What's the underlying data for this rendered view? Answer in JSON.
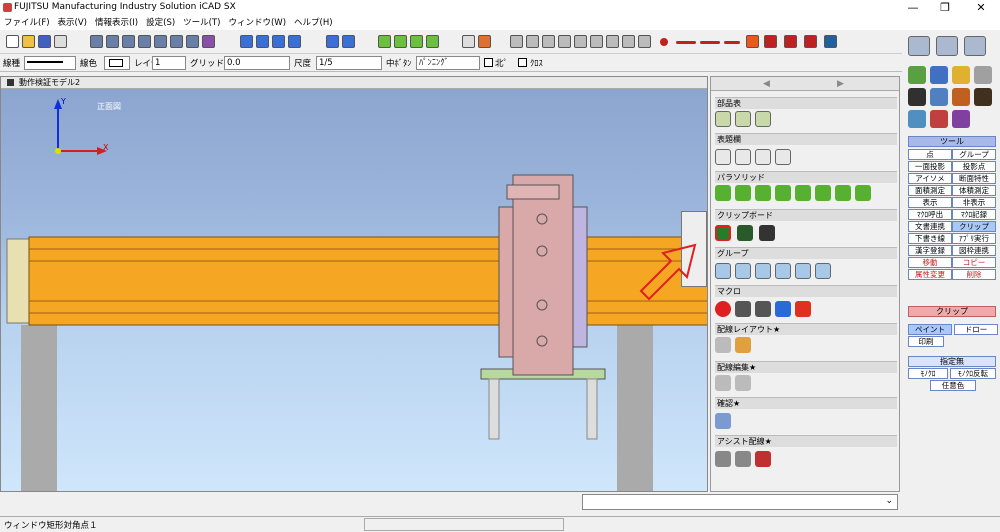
{
  "app": {
    "title": "FUJITSU Manufacturing Industry Solution iCAD SX"
  },
  "window_controls": {
    "minimize": "—",
    "maximize": "❐",
    "close": "✕"
  },
  "menus": [
    "ファイル(F)",
    "表示(V)",
    "情報表示(I)",
    "設定(S)",
    "ツール(T)",
    "ウィンドウ(W)",
    "ヘルプ(H)"
  ],
  "props": {
    "linetype_label": "線種",
    "color_label": "線色",
    "layer_label": "レイヤ",
    "layer_value": "1",
    "grid_label": "グリッド",
    "grid_value": "0.0",
    "scale_label": "尺度",
    "scale_value": "1/5",
    "center_button_label": "中ﾎﾞﾀﾝ",
    "center_button_value": "ﾊﾟﾝﾆﾝｸﾞ",
    "cb1_label": "北ﾟ",
    "cb2_label": "ｸﾛｽ"
  },
  "viewport": {
    "title": "動作検証モデル2",
    "view_label": "正面図",
    "axis_x": "X",
    "axis_y": "Y"
  },
  "side_panel": {
    "sections": [
      "部品表",
      "表題欄",
      "パラソリッド",
      "クリップボード",
      "グループ",
      "マクロ",
      "配線レイアウト★",
      "配線編集★",
      "確認★",
      "アシスト配線★"
    ]
  },
  "right_panel": {
    "tool_header": "ツール",
    "tools": [
      "点",
      "グループ",
      "一面投影",
      "投影点",
      "アイソメ",
      "断面特性",
      "面積測定",
      "体積測定",
      "表示",
      "非表示",
      "ﾏｸﾛ呼出",
      "ﾏｸﾛ記録",
      "文書連携",
      "クリップ",
      "下書き線",
      "ｱﾌﾟﾘ実行",
      "漢字登録",
      "図枠連携",
      "移動",
      "コピー",
      "属性変更",
      "削除"
    ],
    "clip_header": "クリップ",
    "paint_label": "ペイント",
    "draw_label": "ドロー",
    "print_label": "印刷",
    "target_label": "指定無",
    "mono_label": "ﾓﾉｸﾛ",
    "mono_inv_label": "ﾓﾉｸﾛ反転",
    "any_color_label": "任意色"
  },
  "status": {
    "message": "ウィンドウ矩形対角点１"
  },
  "colors": {
    "accent": "#3a6fd8",
    "beam": "#f5a623",
    "cylinder": "#d9a8a8",
    "highlight": "#e02020"
  }
}
